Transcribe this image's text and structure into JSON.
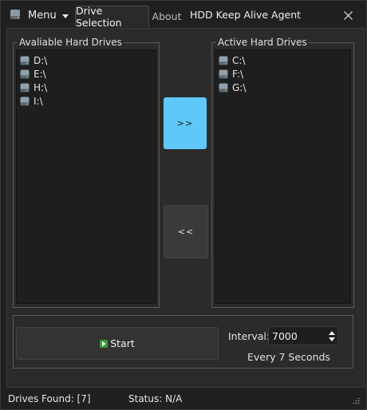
{
  "titlebar": {
    "menu_label": "Menu",
    "tabs": [
      {
        "label": "Drive Selection",
        "active": true
      },
      {
        "label": "About",
        "active": false
      }
    ],
    "window_title": "HDD Keep Alive Agent"
  },
  "available": {
    "title": "Avaliable Hard Drives",
    "items": [
      "D:\\",
      "E:\\",
      "H:\\",
      "I:\\"
    ]
  },
  "active": {
    "title": "Active Hard Drives",
    "items": [
      "C:\\",
      "F:\\",
      "G:\\"
    ]
  },
  "buttons": {
    "move_right": ">>",
    "move_left": "<<",
    "start": "Start"
  },
  "interval": {
    "label": "Interval:",
    "value": "7000",
    "description": "Every 7 Seconds"
  },
  "status": {
    "drives_found": "Drives Found: [7]",
    "state": "Status: N/A"
  },
  "colors": {
    "accent": "#5fc8f8",
    "background": "#202020",
    "panel": "#2b2b2b"
  }
}
